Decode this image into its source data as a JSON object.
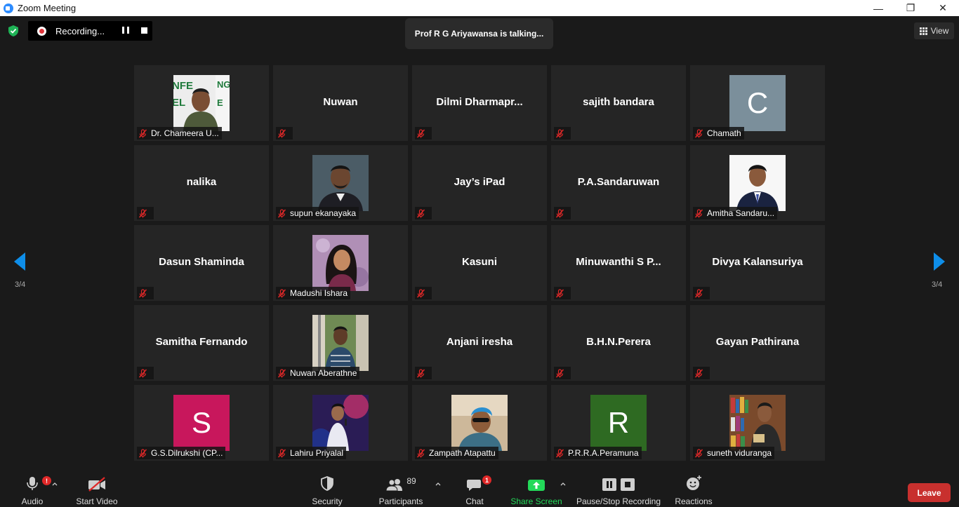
{
  "window": {
    "title": "Zoom Meeting",
    "minimize": "—",
    "restore": "❐",
    "close": "✕"
  },
  "recording": {
    "label": "Recording..."
  },
  "talking": "Prof R G Ariyawansa is talking...",
  "view": {
    "label": "View"
  },
  "pager": {
    "left": "3/4",
    "right": "3/4"
  },
  "participants": [
    {
      "label": "Dr. Chameera U...",
      "type": "photo",
      "photo": "chameera"
    },
    {
      "label": "",
      "name": "Nuwan",
      "type": "name"
    },
    {
      "label": "",
      "name": "Dilmi  Dharmapr...",
      "type": "name"
    },
    {
      "label": "",
      "name": "sajith bandara",
      "type": "name"
    },
    {
      "label": "Chamath",
      "type": "initial",
      "initial": "C",
      "color": "#7b8f9b"
    },
    {
      "label": "",
      "name": "nalika",
      "type": "name"
    },
    {
      "label": "supun ekanayaka",
      "type": "photo",
      "photo": "supun"
    },
    {
      "label": "",
      "name": "Jay’s iPad",
      "type": "name"
    },
    {
      "label": "",
      "name": "P.A.Sandaruwan",
      "type": "name"
    },
    {
      "label": "Amitha Sandaru...",
      "type": "photo",
      "photo": "amitha"
    },
    {
      "label": "",
      "name": "Dasun Shaminda",
      "type": "name"
    },
    {
      "label": "Madushi Ishara",
      "type": "photo",
      "photo": "madushi"
    },
    {
      "label": "",
      "name": "Kasuni",
      "type": "name"
    },
    {
      "label": "",
      "name": "Minuwanthi  S  P...",
      "type": "name"
    },
    {
      "label": "",
      "name": "Divya Kalansuriya",
      "type": "name"
    },
    {
      "label": "",
      "name": "Samitha Fernando",
      "type": "name"
    },
    {
      "label": "Nuwan Aberathne",
      "type": "photo",
      "photo": "aberathne"
    },
    {
      "label": "",
      "name": "Anjani iresha",
      "type": "name"
    },
    {
      "label": "",
      "name": "B.H.N.Perera",
      "type": "name"
    },
    {
      "label": "",
      "name": "Gayan Pathirana",
      "type": "name"
    },
    {
      "label": "G.S.Dilrukshi (CP...",
      "type": "initial",
      "initial": "S",
      "color": "#c8175c"
    },
    {
      "label": "Lahiru Priyalal",
      "type": "photo",
      "photo": "lahiru"
    },
    {
      "label": "Zampath Atapattu",
      "type": "photo",
      "photo": "zampath"
    },
    {
      "label": "P.R.R.A.Peramuna",
      "type": "initial",
      "initial": "R",
      "color": "#2e6a22"
    },
    {
      "label": "suneth viduranga",
      "type": "photo",
      "photo": "suneth"
    }
  ],
  "toolbar": {
    "audio": "Audio",
    "audio_badge": "!",
    "start_video": "Start Video",
    "security": "Security",
    "participants": "Participants",
    "participants_count": "89",
    "chat": "Chat",
    "chat_badge": "1",
    "share_screen": "Share Screen",
    "pause_stop_recording": "Pause/Stop Recording",
    "reactions": "Reactions",
    "leave": "Leave"
  },
  "colors": {
    "share_green": "#23d959",
    "leave_red": "#c8302e",
    "arrow_blue": "#0e8ee9"
  }
}
